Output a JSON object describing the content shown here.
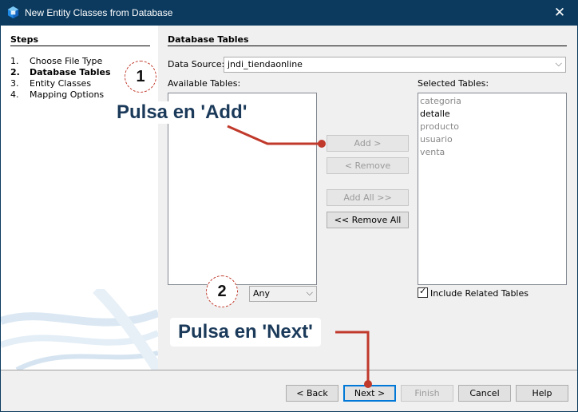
{
  "window": {
    "title": "New Entity Classes from Database",
    "close_glyph": "✕"
  },
  "steps": {
    "title": "Steps",
    "items": [
      {
        "num": "1.",
        "label": "Choose File Type"
      },
      {
        "num": "2.",
        "label": "Database Tables"
      },
      {
        "num": "3.",
        "label": "Entity Classes"
      },
      {
        "num": "4.",
        "label": "Mapping Options"
      }
    ]
  },
  "main": {
    "section_title": "Database Tables",
    "data_source_label": "Data Source:",
    "data_source_value": "jndi_tiendaonline",
    "available_label": "Available Tables:",
    "filter_value": "Any",
    "selected_label": "Selected Tables:",
    "selected_tables": [
      "categoria",
      "detalle",
      "producto",
      "usuario",
      "venta"
    ],
    "include_related_label": "Include Related Tables",
    "include_related_checked": true,
    "buttons": {
      "add": "Add >",
      "remove": "< Remove",
      "add_all": "Add All >>",
      "remove_all": "<< Remove All"
    }
  },
  "footer": {
    "back": "< Back",
    "next": "Next >",
    "finish": "Finish",
    "cancel": "Cancel",
    "help": "Help"
  },
  "annotations": {
    "step1_num": "1",
    "step2_num": "2",
    "callout_add": "Pulsa en 'Add'",
    "callout_next": "Pulsa en 'Next'",
    "accent_color": "#c0392b"
  }
}
